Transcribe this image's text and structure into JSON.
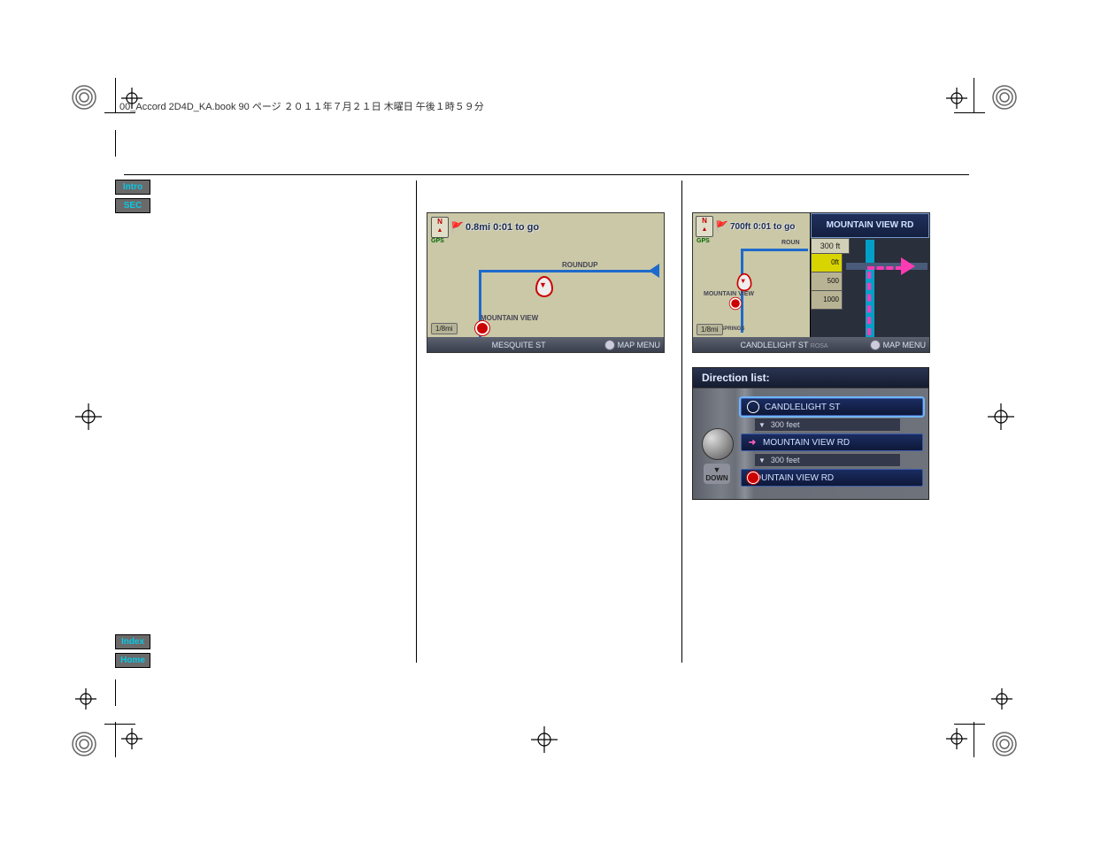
{
  "header_line": "00_Accord 2D4D_KA.book  90 ページ  ２０１１年７月２１日  木曜日  午後１時５９分",
  "tabs": {
    "intro": "Intro",
    "sec": "SEC",
    "index": "Index",
    "home": "Home"
  },
  "screenshot1": {
    "eta": "0.8mi 0:01 to go",
    "gps": "GPS",
    "compass": "N",
    "road_label_1": "ROUNDUP",
    "road_label_2": "MOUNTAIN VIEW",
    "street_bar": "MESQUITE ST",
    "scale": "1/8mi",
    "map_menu": "MAP MENU"
  },
  "screenshot2": {
    "eta": "700ft 0:01 to go",
    "gps": "GPS",
    "turn_title": "MOUNTAIN VIEW RD",
    "distance_tab": "300 ft",
    "ladder": [
      "0ft",
      "500",
      "1000"
    ],
    "road_label_1": "ROUN",
    "road_label_2": "MOUNTAIN VIEW",
    "road_label_3": "ROCK SPRINGS",
    "street_bar": "CANDLELIGHT ST",
    "street_bar_suffix": "ROSA",
    "scale": "1/8mi",
    "map_menu": "MAP MENU"
  },
  "direction_list": {
    "title": "Direction list:",
    "items": [
      {
        "type": "maneuver",
        "icon": "circle",
        "label": "CANDLELIGHT ST",
        "hl": true
      },
      {
        "type": "sub",
        "label": "300 feet"
      },
      {
        "type": "maneuver",
        "icon": "turn",
        "label": "MOUNTAIN VIEW RD"
      },
      {
        "type": "sub",
        "label": "300 feet"
      },
      {
        "type": "maneuver",
        "icon": "dest",
        "label": "MOUNTAIN VIEW RD"
      }
    ],
    "down": "DOWN"
  }
}
